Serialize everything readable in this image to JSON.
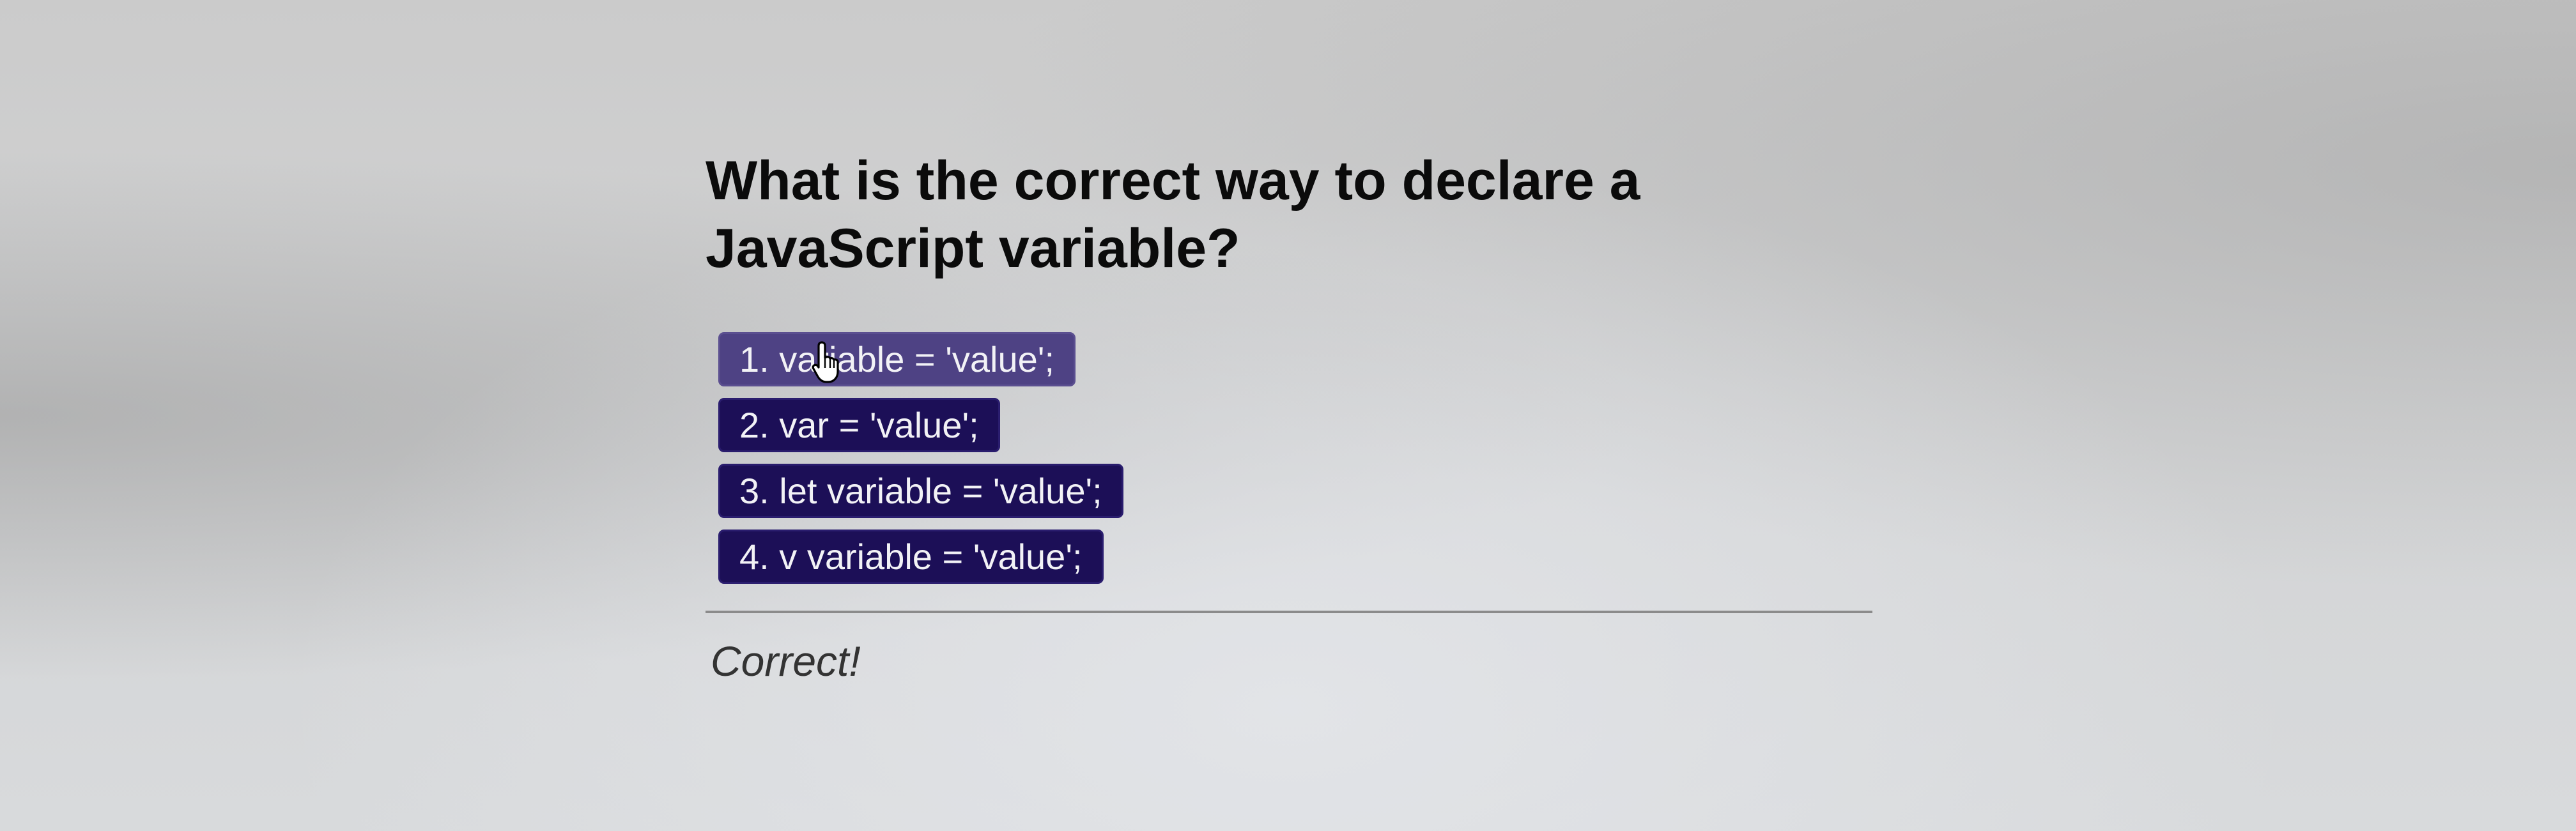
{
  "quiz": {
    "question": "What is the correct way to declare a JavaScript variable?",
    "options": [
      {
        "label": "1. variable = 'value';",
        "hovered": true
      },
      {
        "label": "2. var = 'value';",
        "hovered": false
      },
      {
        "label": "3. let variable = 'value';",
        "hovered": false
      },
      {
        "label": "4. v variable = 'value';",
        "hovered": false
      }
    ],
    "feedback": "Correct!"
  },
  "cursor": {
    "icon": "hand-pointer-icon"
  },
  "colors": {
    "option_background": "#1c0f57",
    "option_hover_background": "#4e4284",
    "option_text": "#f2f2f6",
    "divider": "#8b8b8b",
    "feedback_text": "#333333"
  }
}
